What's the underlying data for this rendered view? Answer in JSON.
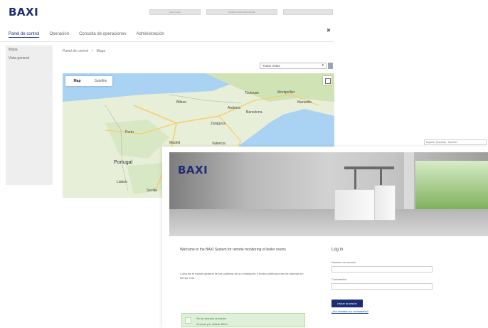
{
  "dashboard": {
    "logo": "BAXI",
    "top_fields": [
      "User Centre",
      "Contact Centre Administrator",
      ""
    ],
    "nav": [
      "Panel de control",
      "Operación",
      "Consulta de operaciones",
      "Administración"
    ],
    "close_label": "✖",
    "sidebar": [
      "Mapa",
      "Vista general"
    ],
    "breadcrumb": [
      "Panel de control",
      "/",
      "Mapa"
    ],
    "view_select": {
      "value": "Todas vistas",
      "chevron": "▾"
    },
    "map": {
      "tabs": [
        "Map",
        "Satellite"
      ],
      "selected_tab": "Map",
      "countries": [
        "Portugal"
      ],
      "cities": [
        "Bilbao",
        "Toulouse",
        "Montpellier",
        "Barcelona",
        "Valencia",
        "Madrid",
        "Zaragoza",
        "Porto",
        "Lisbon",
        "Sevilla",
        "Marseille",
        "Andorra"
      ],
      "colors": {
        "water": "#a9d2f3",
        "land": "#e8efd8",
        "forest": "#cfe3b5",
        "road": "#f5cf6a"
      }
    }
  },
  "login": {
    "language_select": "Español (España) - Spanish",
    "logo": "BAXI",
    "welcome": "Welcome to the BAXI System for remote monitoring of boiler rooms",
    "description": "Consulte el estado general de las calderas de su instalación y reciba notificaciones de alarmas en tiempo real.",
    "success_lines": [
      "Se ha cerrado la sesión",
      "Gracias por utilizar BAXI"
    ],
    "title": "Log in",
    "username_label": "Nombre de usuario",
    "password_label": "Contraseña",
    "button_label": "Iniciar la sesión",
    "forgot_link": "¿Ha olvidado su contraseña?"
  },
  "brand_color": "#1f2c73"
}
